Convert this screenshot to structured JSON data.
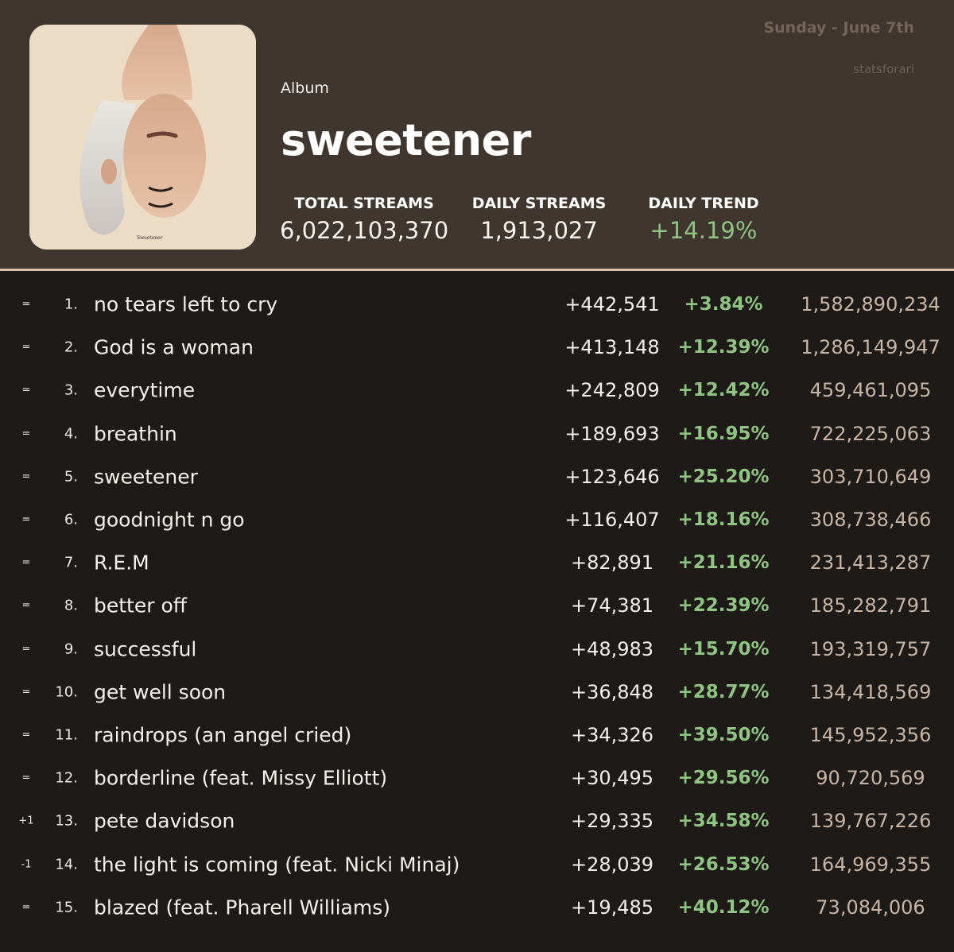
{
  "header": {
    "date": "Sunday - June 7th",
    "handle": "statsforari",
    "album_kind": "Album",
    "album_title": "sweetener",
    "stats": [
      {
        "label": "TOTAL STREAMS",
        "value": "6,022,103,370"
      },
      {
        "label": "DAILY STREAMS",
        "value": "1,913,027"
      },
      {
        "label": "DAILY TREND",
        "value": "+14.19%"
      }
    ]
  },
  "cover": {
    "caption": "Sweetener"
  },
  "colors": {
    "accent_green": "#8fc482",
    "header_bg": "#3f3630",
    "body_bg": "#1e1a17",
    "divider": "#d7c0ad"
  },
  "tracks": [
    {
      "move": "=",
      "rank": "1.",
      "title": "no tears left to cry",
      "daily": "+442,541",
      "pct": "+3.84%",
      "total": "1,582,890,234"
    },
    {
      "move": "=",
      "rank": "2.",
      "title": "God is a woman",
      "daily": "+413,148",
      "pct": "+12.39%",
      "total": "1,286,149,947"
    },
    {
      "move": "=",
      "rank": "3.",
      "title": "everytime",
      "daily": "+242,809",
      "pct": "+12.42%",
      "total": "459,461,095"
    },
    {
      "move": "=",
      "rank": "4.",
      "title": "breathin",
      "daily": "+189,693",
      "pct": "+16.95%",
      "total": "722,225,063"
    },
    {
      "move": "=",
      "rank": "5.",
      "title": "sweetener",
      "daily": "+123,646",
      "pct": "+25.20%",
      "total": "303,710,649"
    },
    {
      "move": "=",
      "rank": "6.",
      "title": "goodnight n go",
      "daily": "+116,407",
      "pct": "+18.16%",
      "total": "308,738,466"
    },
    {
      "move": "=",
      "rank": "7.",
      "title": "R.E.M",
      "daily": "+82,891",
      "pct": "+21.16%",
      "total": "231,413,287"
    },
    {
      "move": "=",
      "rank": "8.",
      "title": "better off",
      "daily": "+74,381",
      "pct": "+22.39%",
      "total": "185,282,791"
    },
    {
      "move": "=",
      "rank": "9.",
      "title": "successful",
      "daily": "+48,983",
      "pct": "+15.70%",
      "total": "193,319,757"
    },
    {
      "move": "=",
      "rank": "10.",
      "title": "get well soon",
      "daily": "+36,848",
      "pct": "+28.77%",
      "total": "134,418,569"
    },
    {
      "move": "=",
      "rank": "11.",
      "title": "raindrops (an angel cried)",
      "daily": "+34,326",
      "pct": "+39.50%",
      "total": "145,952,356"
    },
    {
      "move": "=",
      "rank": "12.",
      "title": "borderline (feat. Missy Elliott)",
      "daily": "+30,495",
      "pct": "+29.56%",
      "total": "90,720,569"
    },
    {
      "move": "+1",
      "rank": "13.",
      "title": "pete davidson",
      "daily": "+29,335",
      "pct": "+34.58%",
      "total": "139,767,226"
    },
    {
      "move": "-1",
      "rank": "14.",
      "title": "the light is coming (feat. Nicki Minaj)",
      "daily": "+28,039",
      "pct": "+26.53%",
      "total": "164,969,355"
    },
    {
      "move": "=",
      "rank": "15.",
      "title": "blazed (feat. Pharell Williams)",
      "daily": "+19,485",
      "pct": "+40.12%",
      "total": "73,084,006"
    }
  ]
}
